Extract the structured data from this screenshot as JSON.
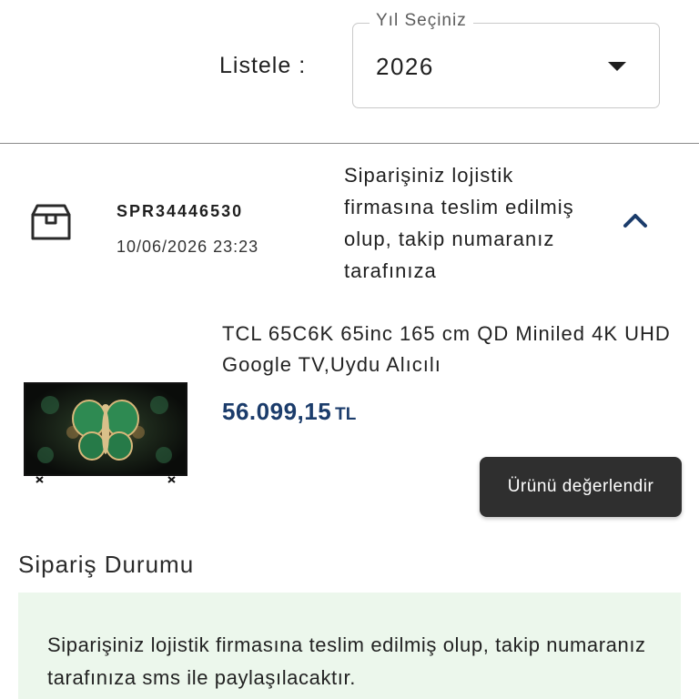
{
  "filter": {
    "list_label": "Listele :",
    "year_legend": "Yıl Seçiniz",
    "year_value": "2026"
  },
  "order": {
    "number": "SPR34446530",
    "date": "10/06/2026 23:23",
    "status_short": "Siparişiniz lojistik firmasına teslim edilmiş olup, takip numaranız tarafınıza",
    "icon": "package-box-icon"
  },
  "product": {
    "name": "TCL 65C6K 65inc 165 cm QD Miniled 4K UHD Google TV,Uydu Alıcılı",
    "price_amount": "56.099,15",
    "price_currency": "TL",
    "rate_button_label": "Ürünü değerlendir"
  },
  "status_section": {
    "title": "Sipariş Durumu",
    "message": "Siparişiniz lojistik firmasına teslim edilmiş olup, takip numaranız tarafınıza sms ile paylaşılacaktır."
  },
  "colors": {
    "price": "#1b3c6b",
    "chevron": "#1b3c6b",
    "status_bg": "#ecf7ec",
    "button_bg": "#2f2f2f"
  }
}
